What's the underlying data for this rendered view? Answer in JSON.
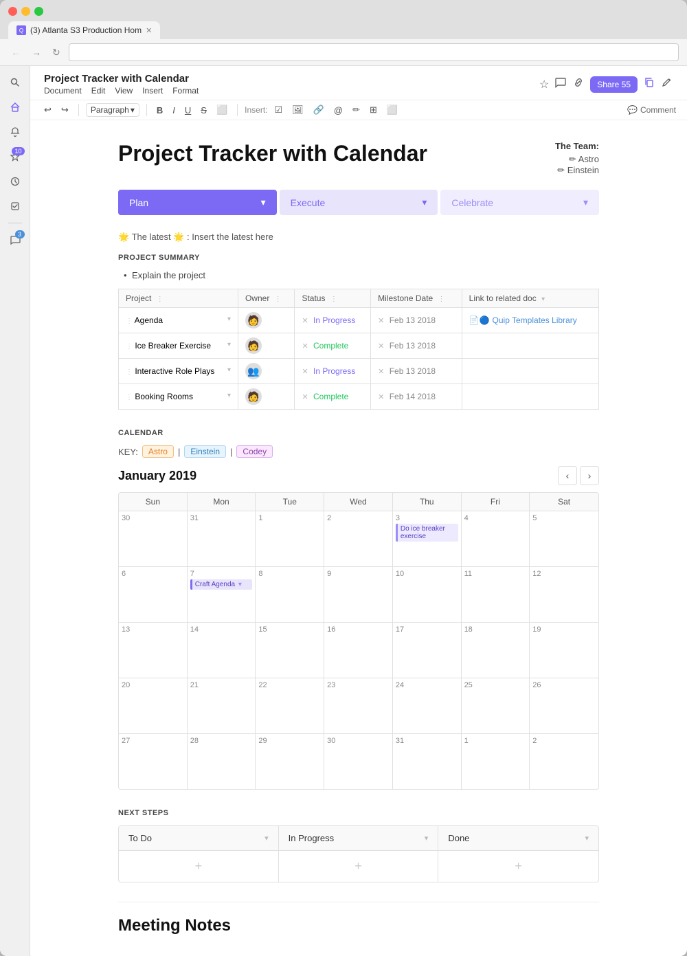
{
  "browser": {
    "tab_label": "(3) Atlanta S3 Production Hom",
    "tab_favicon": "Q",
    "address_bar": ""
  },
  "doc": {
    "title": "Project Tracker with Calendar",
    "menu_items": [
      "Document",
      "Edit",
      "View",
      "Insert",
      "Format"
    ],
    "toolbar": {
      "paragraph_label": "Paragraph",
      "insert_label": "Insert:",
      "comment_label": "Comment"
    },
    "share_label": "Share 55"
  },
  "sidebar": {
    "icons": [
      {
        "name": "search-icon",
        "symbol": "🔍"
      },
      {
        "name": "home-icon",
        "symbol": "⌂"
      },
      {
        "name": "bell-icon",
        "symbol": "🔔"
      },
      {
        "name": "star-icon",
        "symbol": "✦",
        "badge": "10"
      },
      {
        "name": "clock-icon",
        "symbol": "🕐"
      },
      {
        "name": "check-icon",
        "symbol": "☑"
      },
      {
        "name": "minus-icon",
        "symbol": "—"
      },
      {
        "name": "chat-icon",
        "symbol": "💬",
        "badge": "3"
      }
    ]
  },
  "content": {
    "page_title": "Project Tracker with Calendar",
    "team_label": "The Team:",
    "team_members": [
      "✏ Astro",
      "✏ Einstein"
    ],
    "phases": [
      {
        "label": "Plan",
        "style": "active"
      },
      {
        "label": "Execute",
        "style": "light"
      },
      {
        "label": "Celebrate",
        "style": "lighter"
      }
    ],
    "latest_banner": "🌟 The latest 🌟 : Insert the latest here",
    "project_summary_header": "PROJECT SUMMARY",
    "bullet_1": "Explain the project",
    "table": {
      "headers": [
        "Project",
        "Owner",
        "Status",
        "Milestone Date",
        "Link to related doc"
      ],
      "rows": [
        {
          "project": "Agenda",
          "owner": "👤",
          "status": "In Progress",
          "status_type": "in-progress",
          "date": "Feb 13 2018",
          "link": "Quip Templates Library",
          "link_icon": "📄"
        },
        {
          "project": "Ice Breaker Exercise",
          "owner": "👤",
          "status": "Complete",
          "status_type": "complete",
          "date": "Feb 13 2018",
          "link": ""
        },
        {
          "project": "Interactive Role Plays",
          "owner": "👥",
          "status": "In Progress",
          "status_type": "in-progress",
          "date": "Feb 13 2018",
          "link": ""
        },
        {
          "project": "Booking Rooms",
          "owner": "👤",
          "status": "Complete",
          "status_type": "complete",
          "date": "Feb 14 2018",
          "link": ""
        }
      ]
    },
    "calendar": {
      "header": "CALENDAR",
      "key_label": "KEY:",
      "keys": [
        {
          "name": "Astro",
          "style": "astro"
        },
        {
          "name": "Einstein",
          "style": "einstein"
        },
        {
          "name": "Codey",
          "style": "codey"
        }
      ],
      "month": "January 2019",
      "day_labels": [
        "Sun",
        "Mon",
        "Tue",
        "Wed",
        "Thu",
        "Fri",
        "Sat"
      ],
      "weeks": [
        [
          {
            "date": "30",
            "other": true,
            "events": []
          },
          {
            "date": "31",
            "other": true,
            "events": []
          },
          {
            "date": "1",
            "events": []
          },
          {
            "date": "2",
            "events": []
          },
          {
            "date": "3",
            "events": [
              {
                "label": "Do ice breaker exercise",
                "style": "purple"
              }
            ]
          },
          {
            "date": "4",
            "events": []
          },
          {
            "date": "5",
            "events": []
          }
        ],
        [
          {
            "date": "6",
            "events": []
          },
          {
            "date": "7",
            "events": [
              {
                "label": "Craft Agenda",
                "style": "purple"
              }
            ]
          },
          {
            "date": "8",
            "events": []
          },
          {
            "date": "9",
            "events": []
          },
          {
            "date": "10",
            "events": []
          },
          {
            "date": "11",
            "events": []
          },
          {
            "date": "12",
            "events": []
          }
        ],
        [
          {
            "date": "13",
            "events": []
          },
          {
            "date": "14",
            "events": []
          },
          {
            "date": "15",
            "events": []
          },
          {
            "date": "16",
            "events": []
          },
          {
            "date": "17",
            "events": []
          },
          {
            "date": "18",
            "events": []
          },
          {
            "date": "19",
            "events": []
          }
        ],
        [
          {
            "date": "20",
            "events": []
          },
          {
            "date": "21",
            "events": []
          },
          {
            "date": "22",
            "events": []
          },
          {
            "date": "23",
            "events": []
          },
          {
            "date": "24",
            "events": []
          },
          {
            "date": "25",
            "events": []
          },
          {
            "date": "26",
            "events": []
          }
        ],
        [
          {
            "date": "27",
            "events": []
          },
          {
            "date": "28",
            "events": []
          },
          {
            "date": "29",
            "events": []
          },
          {
            "date": "30",
            "events": []
          },
          {
            "date": "31",
            "events": []
          },
          {
            "date": "1",
            "other": true,
            "events": []
          },
          {
            "date": "2",
            "other": true,
            "events": []
          }
        ]
      ]
    },
    "next_steps": {
      "header": "NEXT STEPS",
      "columns": [
        {
          "label": "To Do"
        },
        {
          "label": "In Progress"
        },
        {
          "label": "Done"
        }
      ]
    },
    "meeting_notes_title": "Meeting Notes"
  }
}
